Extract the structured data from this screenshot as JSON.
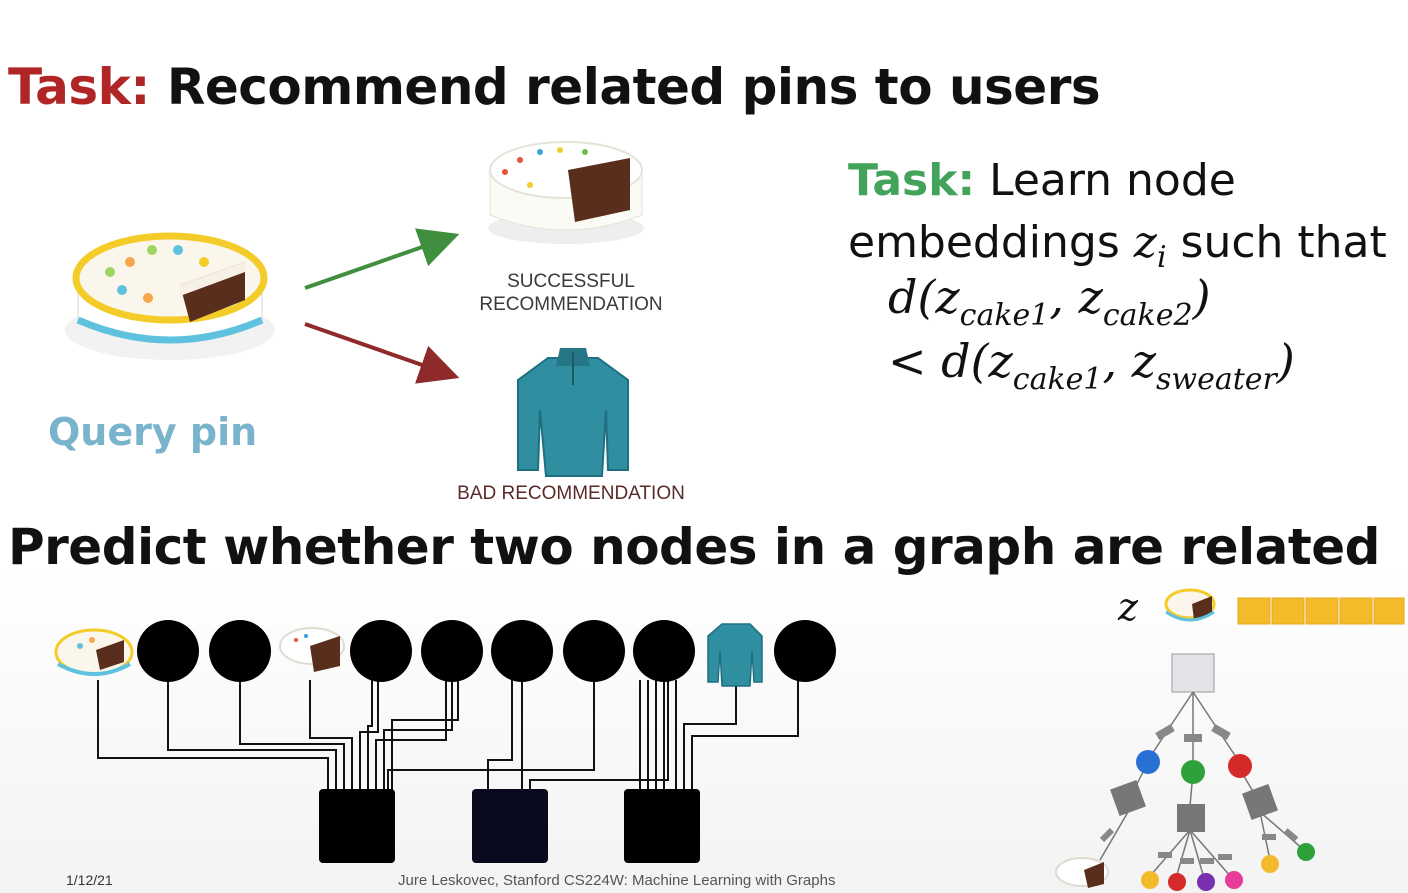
{
  "title": {
    "keyword": "Task:",
    "text": " Recommend related pins to users"
  },
  "query_pin_label": "Query pin",
  "success_caption_line1": "SUCCESSFUL",
  "success_caption_line2": "RECOMMENDATION",
  "bad_caption": "BAD RECOMMENDATION",
  "task_block": {
    "keyword": "Task:",
    "line1_rest": " Learn node",
    "line2_prefix": "embeddings ",
    "z": "z",
    "z_sub": "i",
    "line2_suffix": " such that"
  },
  "equation": {
    "line1": [
      "d(z",
      "cake1",
      ", z",
      "cake2",
      ")"
    ],
    "line2": [
      "< d(z",
      "cake1",
      ", z",
      "sweater",
      ")"
    ]
  },
  "subtitle": "Predict whether two nodes in a graph are related",
  "footer": {
    "date": "1/12/21",
    "credit": "Jure Leskovec, Stanford CS224W: Machine Learning with Graphs"
  },
  "embedding_label": "z",
  "colors": {
    "task_red": "#b02525",
    "task_green": "#44a35a",
    "query_blue": "#7ab4cc",
    "arrow_green": "#3f8f3f",
    "arrow_red": "#8f2a2a",
    "embedding_gold": "#f3bb2a",
    "sweater_teal": "#2f8ea0"
  },
  "icons": [
    "query-cake-icon",
    "sprinkle-cake-icon",
    "sweater-icon"
  ]
}
